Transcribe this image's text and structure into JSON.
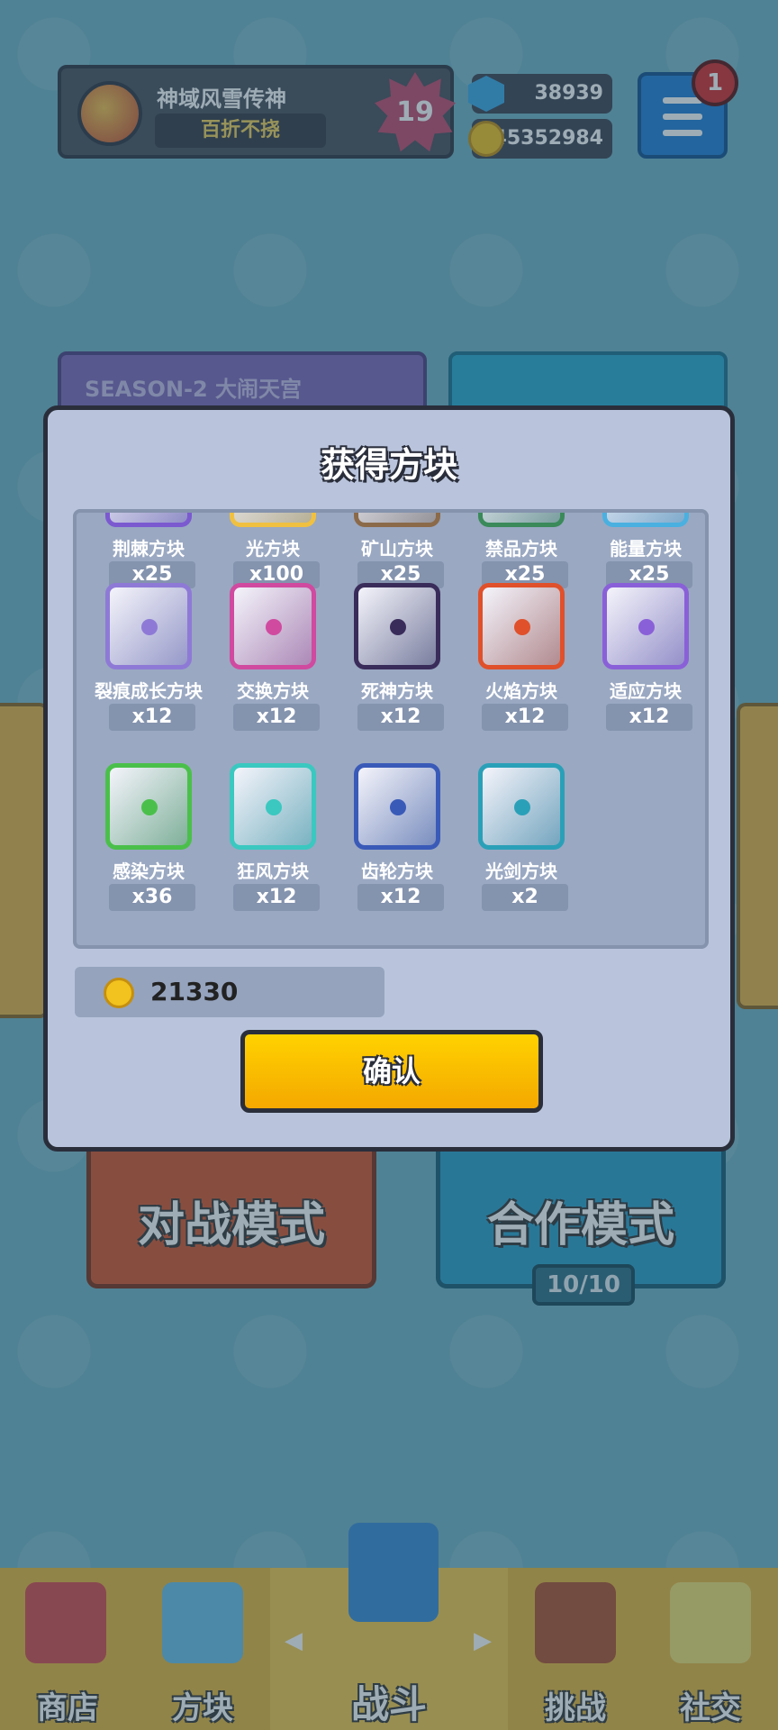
{
  "profile": {
    "name": "神域风雪传神",
    "title": "百折不挠",
    "level": "19"
  },
  "currency": {
    "gems": "38939",
    "coins": "45352984"
  },
  "menu": {
    "notification_count": "1"
  },
  "season_banner": "SEASON-2 大闹天宫",
  "modes": {
    "battle": "对战模式",
    "coop": "合作模式",
    "coop_count": "10/10"
  },
  "dialog": {
    "title": "获得方块",
    "gold_value": "21330",
    "confirm_label": "确认",
    "blocks": [
      {
        "name": "荆棘方块",
        "qty": "x25",
        "color": "#7b5ad0"
      },
      {
        "name": "光方块",
        "qty": "x100",
        "color": "#f0c040"
      },
      {
        "name": "矿山方块",
        "qty": "x25",
        "color": "#8b6a4a"
      },
      {
        "name": "禁品方块",
        "qty": "x25",
        "color": "#3a8a5a"
      },
      {
        "name": "能量方块",
        "qty": "x25",
        "color": "#4ab0e0"
      },
      {
        "name": "裂痕成长方块",
        "qty": "x12",
        "color": "#8e7ad6"
      },
      {
        "name": "交换方块",
        "qty": "x12",
        "color": "#d04aa0"
      },
      {
        "name": "死神方块",
        "qty": "x12",
        "color": "#3a2c5a"
      },
      {
        "name": "火焰方块",
        "qty": "x12",
        "color": "#e0502a"
      },
      {
        "name": "适应方块",
        "qty": "x12",
        "color": "#8a60d8"
      },
      {
        "name": "感染方块",
        "qty": "x36",
        "color": "#4ac04a"
      },
      {
        "name": "狂风方块",
        "qty": "x12",
        "color": "#3ac8c0"
      },
      {
        "name": "齿轮方块",
        "qty": "x12",
        "color": "#3a5ab8"
      },
      {
        "name": "光剑方块",
        "qty": "x2",
        "color": "#2aa0b8"
      }
    ]
  },
  "bottom_nav": [
    {
      "label": "商店"
    },
    {
      "label": "方块"
    },
    {
      "label": "战斗"
    },
    {
      "label": "挑战"
    },
    {
      "label": "社交"
    }
  ]
}
